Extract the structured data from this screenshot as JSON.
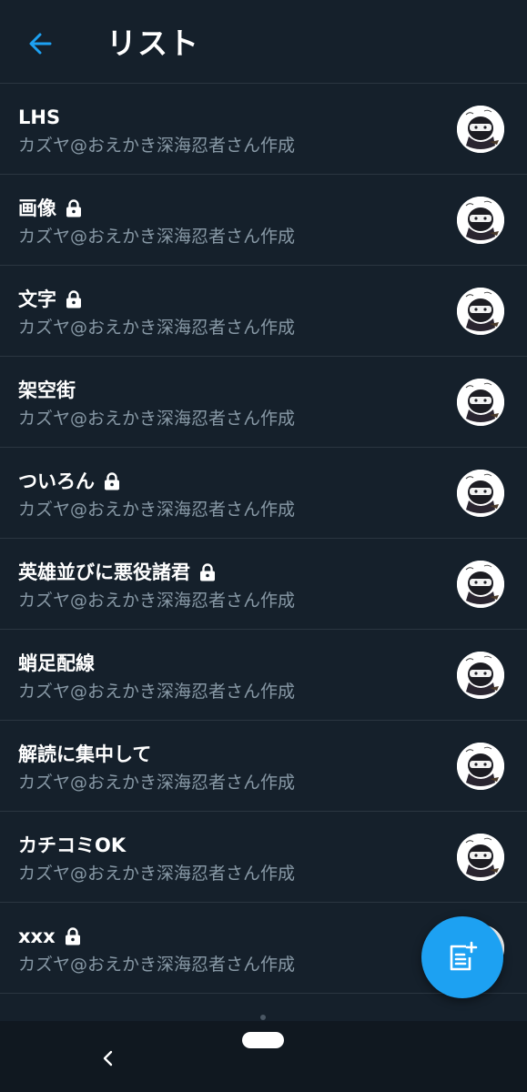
{
  "header": {
    "title": "リスト",
    "back_icon": "arrow-left-icon",
    "accent_color": "#1da1f2"
  },
  "lists": [
    {
      "name": "LHS",
      "owner": "カズヤ@おえかき深海忍者さん作成",
      "locked": false
    },
    {
      "name": "画像",
      "owner": "カズヤ@おえかき深海忍者さん作成",
      "locked": true
    },
    {
      "name": "文字",
      "owner": "カズヤ@おえかき深海忍者さん作成",
      "locked": true
    },
    {
      "name": "架空街",
      "owner": "カズヤ@おえかき深海忍者さん作成",
      "locked": false
    },
    {
      "name": "ついろん",
      "owner": "カズヤ@おえかき深海忍者さん作成",
      "locked": true
    },
    {
      "name": "英雄並びに悪役諸君",
      "owner": "カズヤ@おえかき深海忍者さん作成",
      "locked": true
    },
    {
      "name": "蛸足配線",
      "owner": "カズヤ@おえかき深海忍者さん作成",
      "locked": false
    },
    {
      "name": "解読に集中して",
      "owner": "カズヤ@おえかき深海忍者さん作成",
      "locked": false
    },
    {
      "name": "カチコミOK",
      "owner": "カズヤ@おえかき深海忍者さん作成",
      "locked": false
    },
    {
      "name": "xxx",
      "owner": "カズヤ@おえかき深海忍者さん作成",
      "locked": true
    }
  ],
  "fab": {
    "icon": "new-list-icon"
  },
  "system_nav": {
    "back_icon": "chevron-left-icon",
    "home_icon": "home-pill-icon"
  },
  "colors": {
    "background": "#15202b",
    "divider": "#2a3540",
    "secondary_text": "#8899a6",
    "fab": "#1da1f2"
  }
}
